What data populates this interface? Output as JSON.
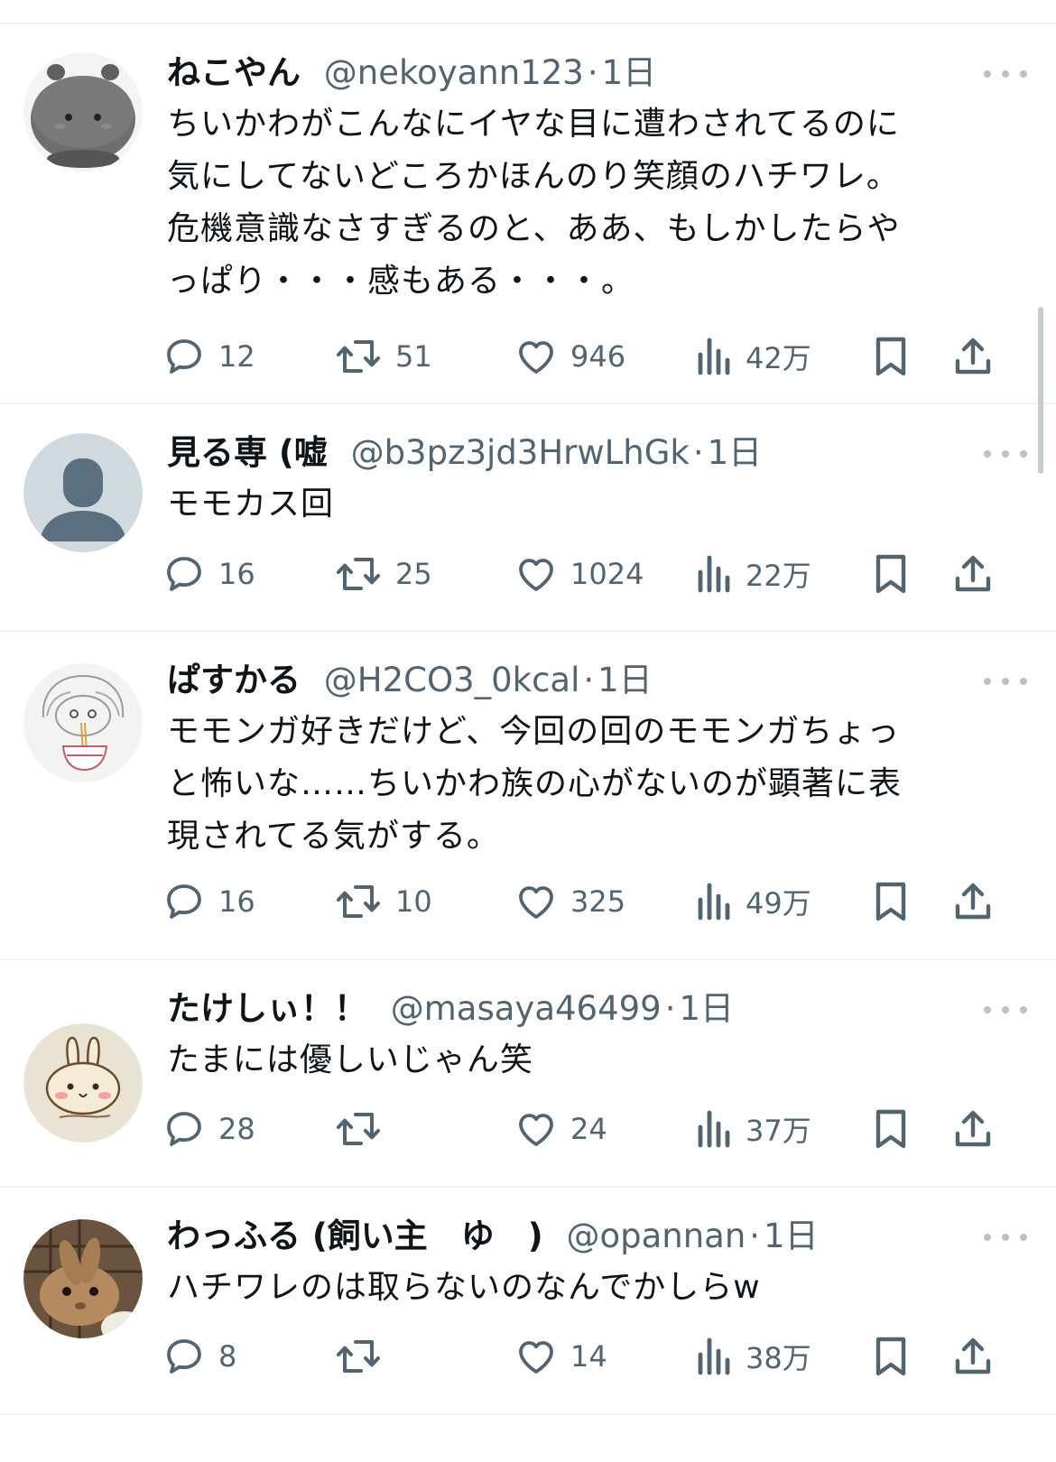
{
  "tweets": [
    {
      "name": "ねこやん",
      "handle": "@nekoyann123",
      "separator": "·",
      "time": "1日",
      "text": "ちいかわがこんなにイヤな目に遭わされてるのに\n気にしてないどころかほんのり笑顔のハチワレ。\n危機意識なさすぎるのと、ああ、もしかしたらや\nっぱり・・・感もある・・・。",
      "replies": "12",
      "retweets": "51",
      "likes": "946",
      "views": "42万",
      "avatar": "gray-plush-creature"
    },
    {
      "name": "見る専 (嘘",
      "handle": "@b3pz3jd3HrwLhGk",
      "separator": "·",
      "time": "1日",
      "text": "モモカス回",
      "replies": "16",
      "retweets": "25",
      "likes": "1024",
      "views": "22万",
      "avatar": "default-profile"
    },
    {
      "name": "ぱすかる",
      "handle": "@H2CO3_0kcal",
      "separator": "·",
      "time": "1日",
      "text": "モモンガ好きだけど、今回の回のモモンガちょっ\nと怖いな……ちいかわ族の心がないのが顕著に表\n現されてる気がする。",
      "replies": "16",
      "retweets": "10",
      "likes": "325",
      "views": "49万",
      "avatar": "sketch-noodles"
    },
    {
      "name": "たけしぃ！！",
      "handle": "@masaya46499",
      "separator": "·",
      "time": "1日",
      "text": "たまには優しいじゃん笑",
      "replies": "28",
      "retweets": "",
      "likes": "24",
      "views": "37万",
      "avatar": "usagi-drawing"
    },
    {
      "name": "わっふる (飼い主　ゆ　)",
      "handle": "@opannan",
      "separator": "·",
      "time": "1日",
      "text": "ハチワレのは取らないのなんでかしらw",
      "replies": "8",
      "retweets": "",
      "likes": "14",
      "views": "38万",
      "avatar": "rabbit-photo"
    }
  ],
  "icons": {
    "reply": "reply-icon",
    "retweet": "retweet-icon",
    "like": "heart-icon",
    "views": "views-chart-icon",
    "bookmark": "bookmark-icon",
    "share": "share-icon",
    "more": "more-icon"
  },
  "colors": {
    "text": "#0f1419",
    "secondary": "#536471",
    "divider": "#eff3f4"
  }
}
